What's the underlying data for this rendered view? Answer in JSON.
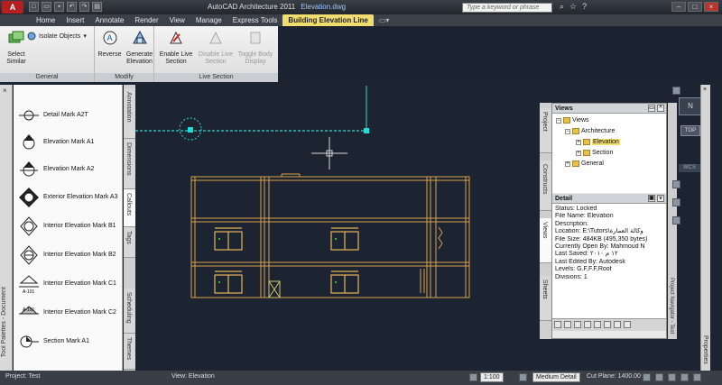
{
  "app": {
    "title": "AutoCAD Architecture 2011",
    "document": "Elevation.dwg",
    "logo": "A",
    "search_placeholder": "Type a keyword or phrase"
  },
  "ribbon_tabs": [
    "Home",
    "Insert",
    "Annotate",
    "Render",
    "View",
    "Manage",
    "Express Tools",
    "Building Elevation Line"
  ],
  "ribbon": {
    "general": {
      "title": "General",
      "select_similar": "Select Similar",
      "isolate_objects": "Isolate Objects"
    },
    "modify": {
      "title": "Modify",
      "reverse": "Reverse",
      "generate_elevation": "Generate Elevation"
    },
    "live_section": {
      "title": "Live Section",
      "enable": "Enable Live Section",
      "disable": "Disable Live Section",
      "toggle": "Toggle Body Display"
    }
  },
  "tool_palette": {
    "strip_label": "Tool Palettes - Document",
    "items": [
      "Detail Mark A2T",
      "Elevation Mark A1",
      "Elevation Mark A2",
      "Exterior Elevation Mark A3",
      "Interior Elevation Mark B1",
      "Interior Elevation Mark B2",
      "Interior Elevation Mark C1",
      "Interior Elevation Mark C2",
      "Section Mark A1"
    ],
    "tabs": [
      "Annotation",
      "Dimensions",
      "Callouts",
      "Tags",
      "Scheduling",
      "Themes"
    ],
    "active_tab": "Callouts"
  },
  "project_navigator": {
    "strip_label": "Project Navigator - Test",
    "side_tabs": [
      "Project",
      "Constructs",
      "Views",
      "Sheets"
    ],
    "views_header": "Views",
    "tree": {
      "root": "Views",
      "architecture": "Architecture",
      "elevation": "Elevation",
      "section": "Section",
      "general": "General"
    },
    "detail_header": "Detail",
    "detail_lines": [
      "Status: Locked",
      "File Name: Elevation",
      "Description:",
      "Location: E:\\Tutors\\وكالة العمارة",
      "File Size: 484KB (495,350 bytes)",
      "Currently Open By: Mahmoud N",
      "Last Saved: ١٢ م ٢٠١٠",
      "Last Edited By: Autodesk",
      "Levels: G.F,F.F,Roof",
      "Divisions: 1"
    ]
  },
  "viewcube": {
    "face": "N",
    "top_button": "TOP",
    "wcs": "WCS"
  },
  "properties": {
    "label": "Properties"
  },
  "status_bar": {
    "left": "Project: Test",
    "view": "View: Elevation",
    "scale": "1:100",
    "detail_level": "Medium Detail",
    "cut_plane": "Cut Plane: 1400.00"
  },
  "colors": {
    "drawing_bg": "#1c2431",
    "elevation_lines": "#d9a24a",
    "window_color": "#e6b45a",
    "marker_color": "#1ee0d8",
    "contextual_tab": "#f1dd6e"
  }
}
